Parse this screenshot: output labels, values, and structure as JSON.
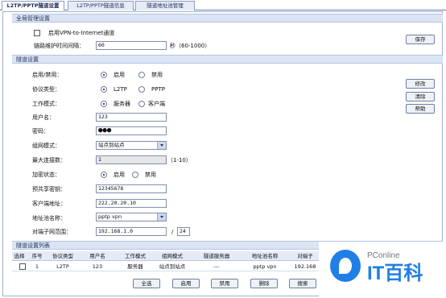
{
  "tabs": [
    "L2TP/PPTP隧道设置",
    "L2TP/PPTP隧道信息",
    "隧道地址池管理"
  ],
  "global": {
    "title": "全局管理设置",
    "enable_vpn_label": "启用VPN-to-Internet通道",
    "enable_vpn_checked": false,
    "keepalive_label": "链路维护时间间隔：",
    "keepalive_value": "60",
    "keepalive_unit": "秒（60-1000）",
    "save_button": "保存"
  },
  "tunnel": {
    "title": "隧道设置",
    "enable": {
      "label": "启用/禁用：",
      "opt_on": "启用",
      "opt_off": "禁用",
      "selected": "启用"
    },
    "protocol": {
      "label": "协议类型：",
      "opt_a": "L2TP",
      "opt_b": "PPTP",
      "selected": "L2TP"
    },
    "mode": {
      "label": "工作模式：",
      "opt_a": "服务器",
      "opt_b": "客户端",
      "selected": "服务器"
    },
    "username": {
      "label": "用户名：",
      "value": "123"
    },
    "password": {
      "label": "密码：",
      "value": "●●●"
    },
    "network_mode": {
      "label": "组网模式：",
      "value": "站点到站点"
    },
    "max_conn": {
      "label": "最大连接数：",
      "value": "1",
      "range": "（1-10）"
    },
    "encryption": {
      "label": "加密状态：",
      "opt_on": "启用",
      "opt_off": "禁用",
      "selected": "启用"
    },
    "psk": {
      "label": "预共享密钥：",
      "value": "12345678"
    },
    "client_addr": {
      "label": "客户端地址：",
      "value": "222.20.20.10"
    },
    "pool": {
      "label": "地址池名称：",
      "value": "pptp vpn"
    },
    "peer_subnet": {
      "label": "对端子网范围：",
      "value": "192.168.1.0",
      "sep": "/",
      "mask": "24"
    },
    "buttons": {
      "modify": "修改",
      "clear": "清除",
      "help": "帮助"
    }
  },
  "list": {
    "title": "隧道设置列表",
    "headers": [
      "选择",
      "序号",
      "协议类型",
      "用户名",
      "工作模式",
      "组网模式",
      "隧道服务器",
      "地址池名称",
      "对端子"
    ],
    "rows": [
      [
        "",
        "1",
        "L2TP",
        "123",
        "服务器",
        "站点到站点",
        "---",
        "pptp vpn",
        "192.168"
      ]
    ],
    "buttons": {
      "select_all": "全选",
      "enable": "启用",
      "disable": "禁用",
      "delete": "删除",
      "search": "搜索"
    }
  },
  "watermark": {
    "brand_small": "PConline",
    "brand_big": "IT百科"
  }
}
